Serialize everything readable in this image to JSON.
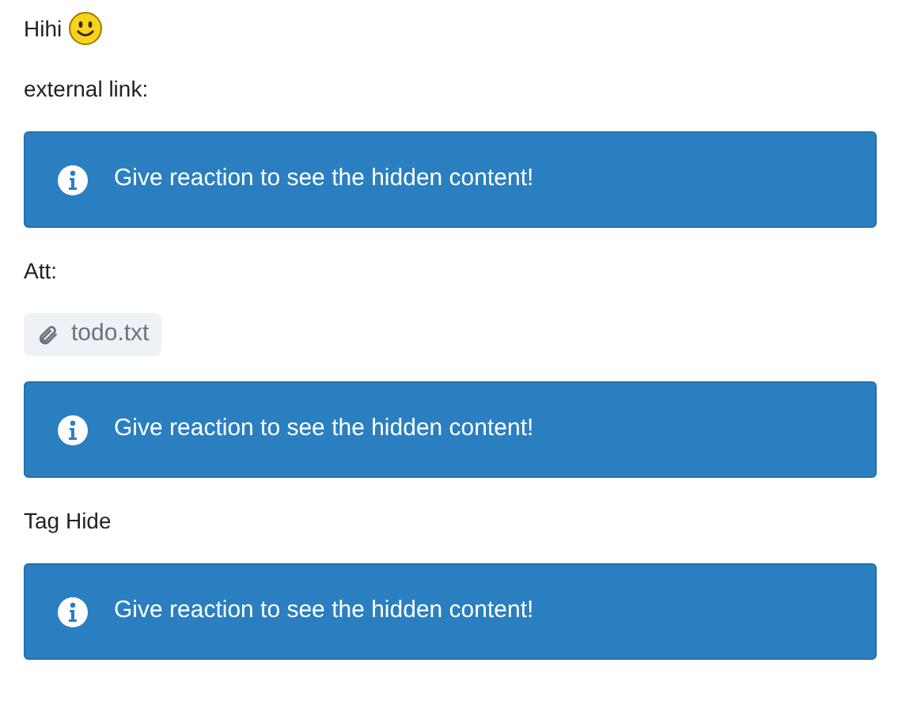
{
  "blocks": [
    {
      "kind": "smiley_text",
      "text": "Hihi"
    },
    {
      "kind": "text",
      "text": "external link:"
    },
    {
      "kind": "notice",
      "text": "Give reaction to see the hidden content!"
    },
    {
      "kind": "text",
      "text": "Att:"
    },
    {
      "kind": "attachment",
      "text": "todo.txt"
    },
    {
      "kind": "notice",
      "text": "Give reaction to see the hidden content!"
    },
    {
      "kind": "text",
      "text": "Tag Hide"
    },
    {
      "kind": "notice",
      "text": "Give reaction to see the hidden content!"
    }
  ]
}
